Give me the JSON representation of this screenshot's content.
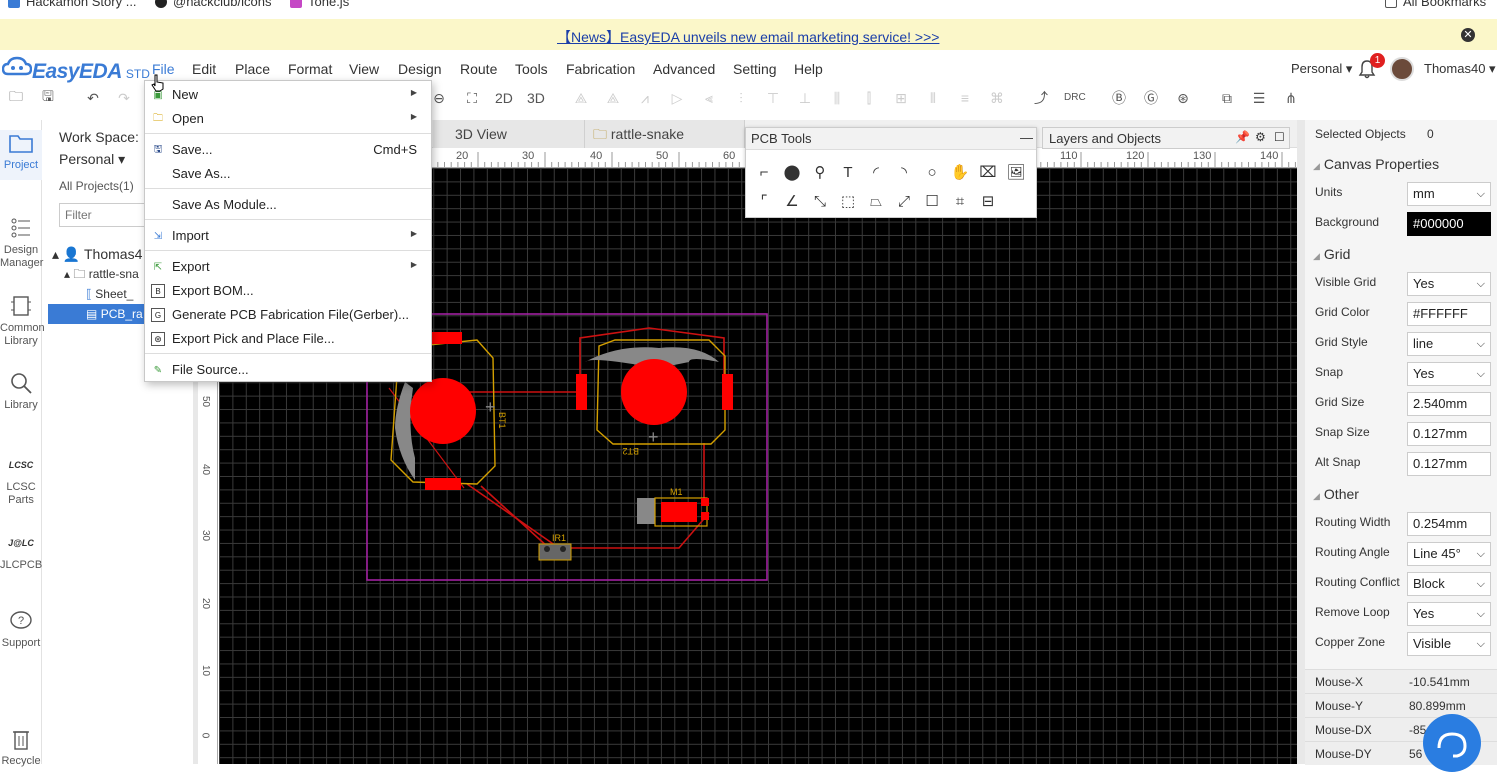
{
  "bookmarks": [
    "Hackamon Story ...",
    "@hackclub/icons",
    "Tone.js",
    "All Bookmarks"
  ],
  "news": {
    "text": "【News】EasyEDA unveils new email marketing service! >>>",
    "close_icon": "close-icon"
  },
  "app": {
    "name": "EasyEDA",
    "edition": "STD"
  },
  "menu": [
    "File",
    "Edit",
    "Place",
    "Format",
    "View",
    "Design",
    "Route",
    "Tools",
    "Fabrication",
    "Advanced",
    "Setting",
    "Help"
  ],
  "account": {
    "workspace": "Personal",
    "notifications": "1",
    "user": "Thomas40"
  },
  "toolbar": {
    "view2d": "2D",
    "view3d": "3D",
    "drc": "DRC"
  },
  "leftnav": [
    {
      "label": "Project",
      "icon": "folder-icon"
    },
    {
      "label": "Design Manager",
      "icon": "design-manager-icon"
    },
    {
      "label": "Common Library",
      "icon": "library-icon"
    },
    {
      "label": "Library",
      "icon": "search-icon"
    },
    {
      "label": "LCSC Parts",
      "icon": "lcsc-icon"
    },
    {
      "label": "JLCPCB",
      "icon": "jlc-icon"
    },
    {
      "label": "Support",
      "icon": "help-icon"
    },
    {
      "label": "Recycle",
      "icon": "trash-icon"
    }
  ],
  "project_panel": {
    "workspace_label": "Work Space:",
    "workspace_value": "Personal",
    "all_projects": "All Projects(1)",
    "filter_placeholder": "Filter",
    "tree": [
      "Thomas4",
      "rattle-sna",
      "Sheet_",
      "PCB_ra"
    ]
  },
  "tabs": [
    "3D View",
    "rattle-snake"
  ],
  "pcb_tools": {
    "title": "PCB Tools"
  },
  "layers_panel": {
    "title": "Layers and Objects"
  },
  "ruler": {
    "top": [
      "20",
      "30",
      "40",
      "50",
      "60",
      "110",
      "120",
      "130",
      "140"
    ],
    "left": [
      "50",
      "40",
      "30",
      "20",
      "10",
      "0"
    ]
  },
  "board": {
    "labels": [
      "BT1",
      "BT2",
      "M1",
      "IR1"
    ]
  },
  "properties": {
    "selected_label": "Selected Objects",
    "selected_count": "0",
    "canvas_title": "Canvas Properties",
    "units_label": "Units",
    "units": "mm",
    "background_label": "Background",
    "background": "#000000",
    "grid_title": "Grid",
    "visible_grid_label": "Visible Grid",
    "visible_grid": "Yes",
    "grid_color_label": "Grid Color",
    "grid_color": "#FFFFFF",
    "grid_style_label": "Grid Style",
    "grid_style": "line",
    "snap_label": "Snap",
    "snap": "Yes",
    "grid_size_label": "Grid Size",
    "grid_size": "2.540mm",
    "snap_size_label": "Snap Size",
    "snap_size": "0.127mm",
    "alt_snap_label": "Alt Snap",
    "alt_snap": "0.127mm",
    "other_title": "Other",
    "routing_width_label": "Routing Width",
    "routing_width": "0.254mm",
    "routing_angle_label": "Routing Angle",
    "routing_angle": "Line 45°",
    "routing_conflict_label": "Routing Conflict",
    "routing_conflict": "Block",
    "remove_loop_label": "Remove Loop",
    "remove_loop": "Yes",
    "copper_zone_label": "Copper Zone",
    "copper_zone": "Visible"
  },
  "mouse": {
    "x_label": "Mouse-X",
    "x": "-10.541mm",
    "y_label": "Mouse-Y",
    "y": "80.899mm",
    "dx_label": "Mouse-DX",
    "dx": "-85",
    "dy_label": "Mouse-DY",
    "dy": "56"
  },
  "file_menu": {
    "new": "New",
    "open": "Open",
    "save": "Save...",
    "save_shortcut": "Cmd+S",
    "save_as": "Save As...",
    "save_as_module": "Save As Module...",
    "import": "Import",
    "export": "Export",
    "export_bom": "Export BOM...",
    "gerber": "Generate PCB Fabrication File(Gerber)...",
    "pick_place": "Export Pick and Place File...",
    "file_source": "File Source..."
  }
}
